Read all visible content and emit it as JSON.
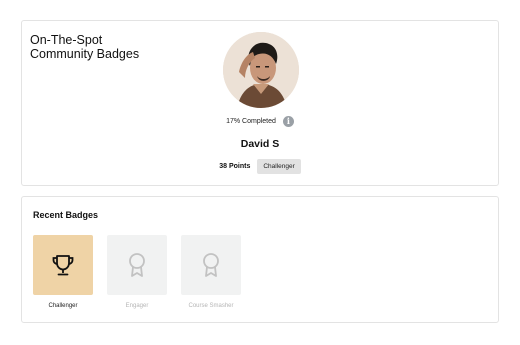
{
  "profile": {
    "title": "On-The-Spot\nCommunity Badges",
    "progress_text": "17% Completed",
    "info_glyph": "i",
    "name": "David S",
    "points": "38 Points",
    "level": "Challenger"
  },
  "recent_badges": {
    "heading": "Recent Badges",
    "items": [
      {
        "label": "Challenger",
        "icon": "trophy-icon",
        "earned": true
      },
      {
        "label": "Engager",
        "icon": "ribbon-medal-icon",
        "earned": false
      },
      {
        "label": "Course Smasher",
        "icon": "ribbon-medal-icon",
        "earned": false
      }
    ]
  },
  "colors": {
    "earned_tile": "#efd3a6",
    "locked_tile": "#f1f2f2",
    "locked_icon": "#c2c2c2",
    "border": "#e3e3e3"
  }
}
